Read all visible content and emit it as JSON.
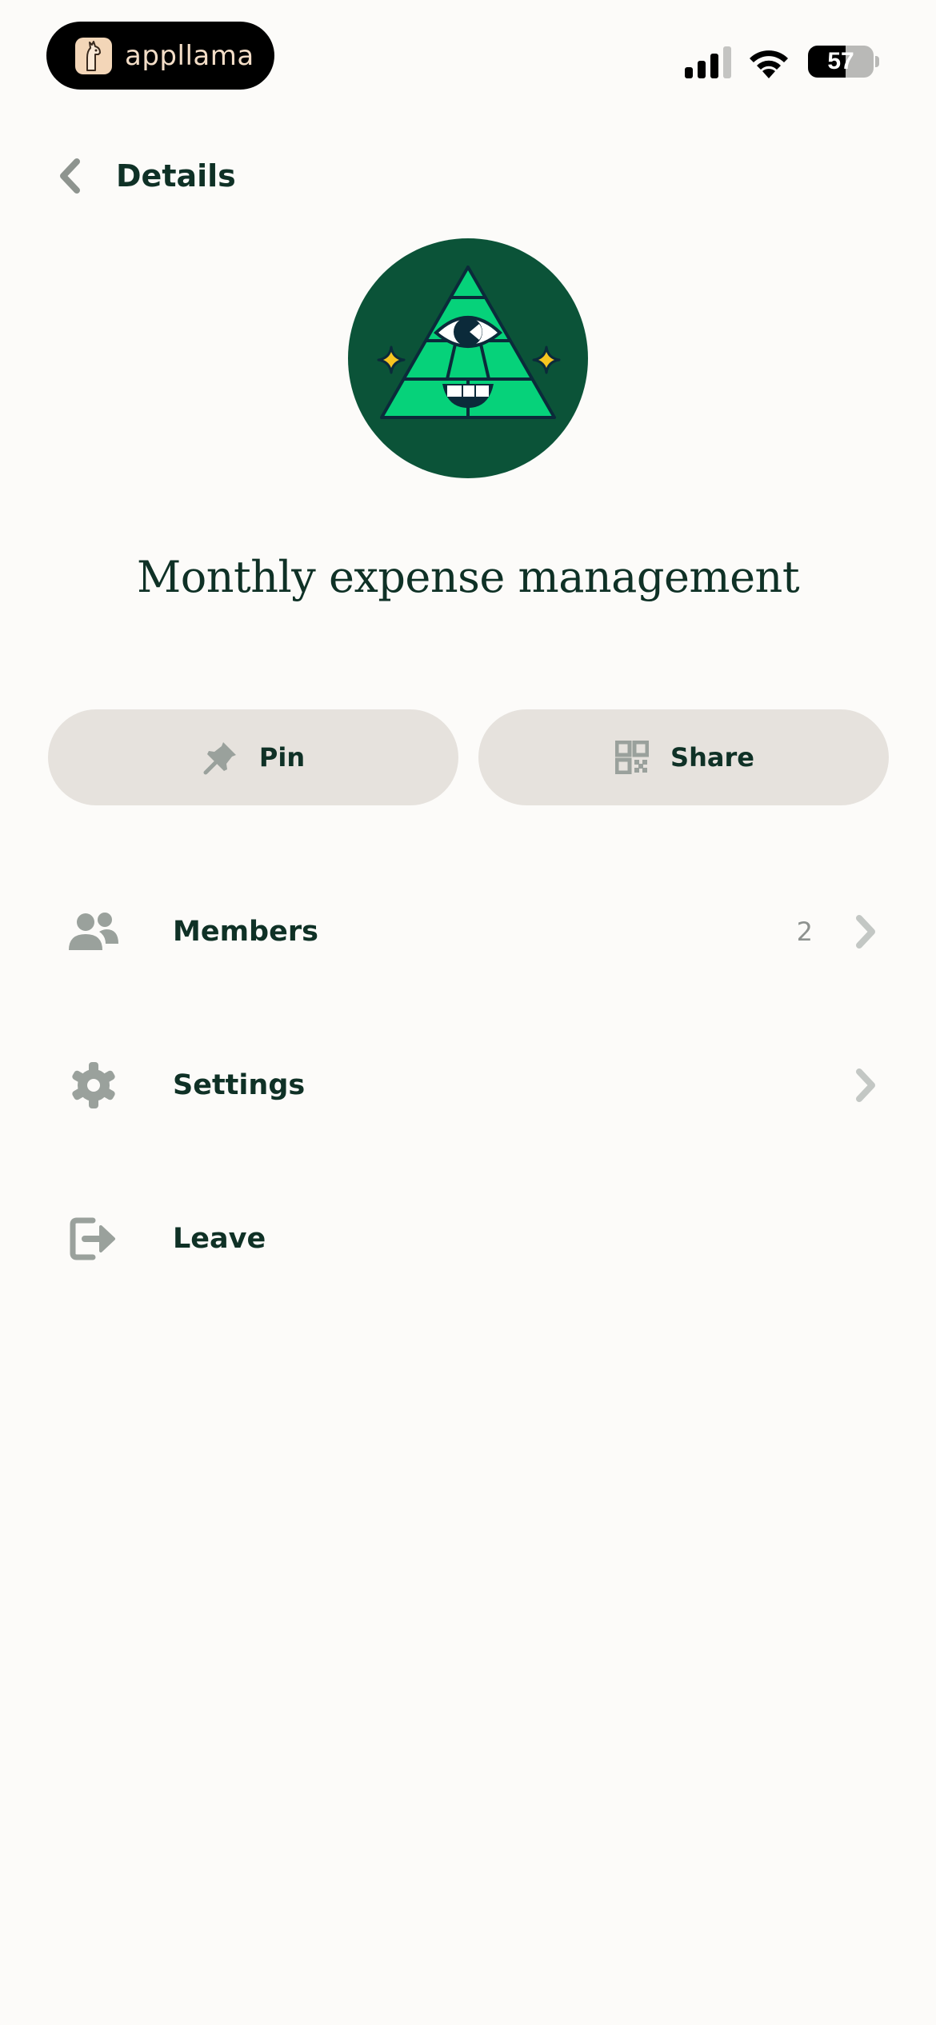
{
  "status_bar": {
    "app_name": "appllama",
    "battery_percent": "57",
    "llama_icon": "llama-icon",
    "signal_icon": "cellular-signal-icon",
    "wifi_icon": "wifi-icon"
  },
  "header": {
    "title": "Details",
    "back_icon": "chevron-left-icon"
  },
  "group": {
    "name": "Monthly expense management",
    "avatar_icon": "eye-pyramid-icon",
    "avatar_bg": "#0b5338",
    "avatar_accent": "#06d27a",
    "sparkle_color": "#f7c520"
  },
  "actions": {
    "pin": {
      "label": "Pin",
      "icon": "pushpin-icon"
    },
    "share": {
      "label": "Share",
      "icon": "qr-code-icon"
    }
  },
  "menu": {
    "items": [
      {
        "label": "Members",
        "count": "2",
        "icon": "people-icon",
        "chevron": "chevron-right-icon"
      },
      {
        "label": "Settings",
        "icon": "gear-icon",
        "chevron": "chevron-right-icon"
      },
      {
        "label": "Leave",
        "icon": "exit-icon"
      }
    ]
  },
  "colors": {
    "background": "#fcfbf9",
    "text": "#0f3126",
    "button_bg": "#e6e2dd",
    "icon_gray": "#9aa19c"
  }
}
